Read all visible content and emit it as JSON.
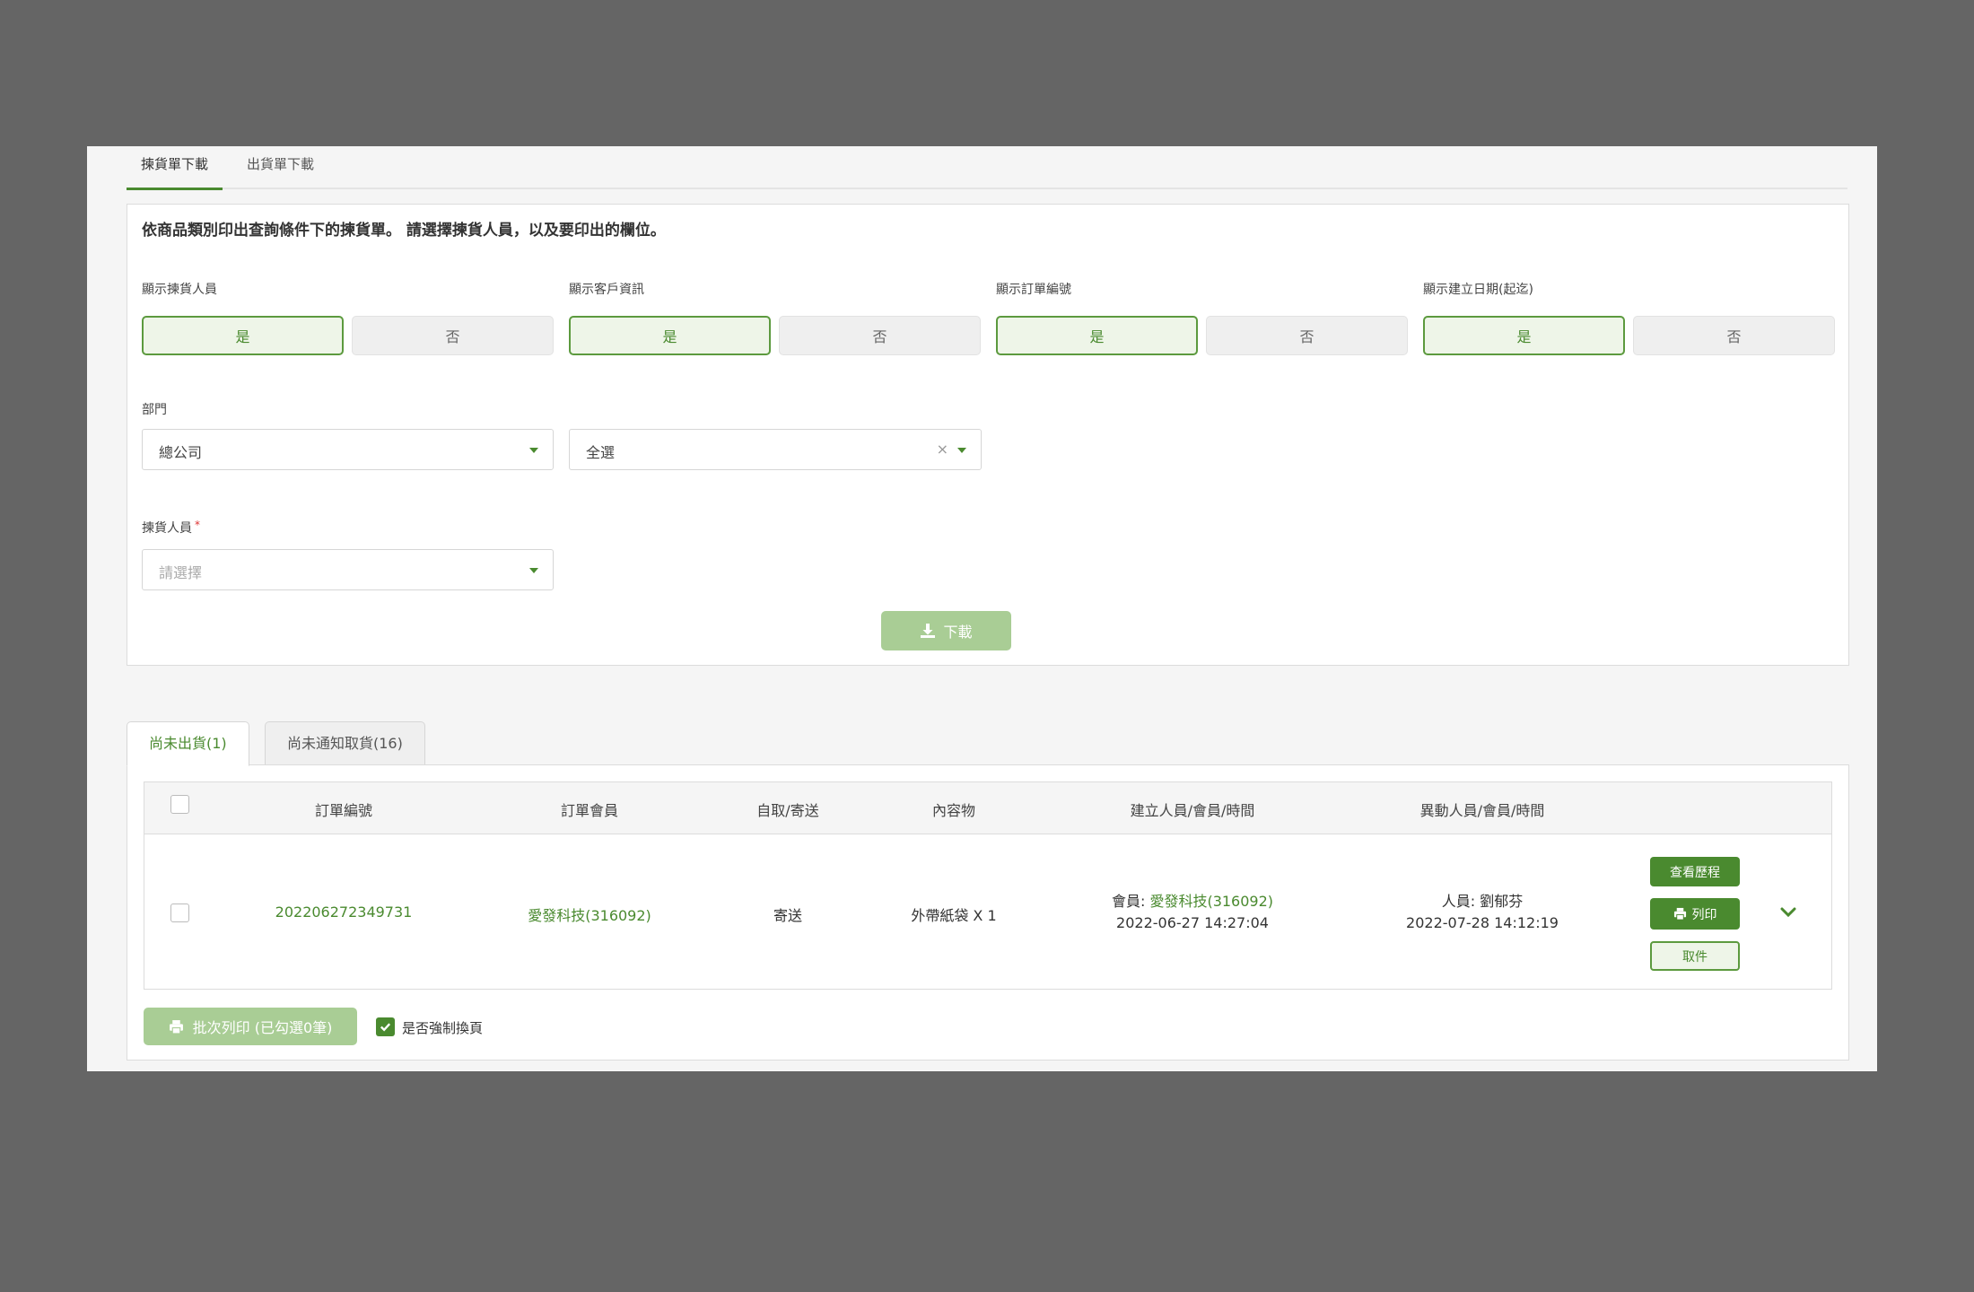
{
  "top_tabs": [
    {
      "label": "揀貨單下載",
      "active": true
    },
    {
      "label": "出貨單下載",
      "active": false
    }
  ],
  "card": {
    "description": "依商品類別印出查詢條件下的揀貨單。 請選擇揀貨人員，以及要印出的欄位。",
    "options": [
      {
        "label": "顯示揀貨人員",
        "yes": "是",
        "no": "否"
      },
      {
        "label": "顯示客戶資訊",
        "yes": "是",
        "no": "否"
      },
      {
        "label": "顯示訂單編號",
        "yes": "是",
        "no": "否"
      },
      {
        "label": "顯示建立日期(起迄)",
        "yes": "是",
        "no": "否"
      }
    ],
    "department_label": "部門",
    "department_value": "總公司",
    "department_sub_value": "全選",
    "picker_label": "揀貨人員",
    "picker_required": "*",
    "picker_placeholder": "請選擇",
    "download_label": "下載"
  },
  "sub_tabs": [
    {
      "label": "尚未出貨(1)",
      "active": true
    },
    {
      "label": "尚未通知取貨(16)",
      "active": false
    }
  ],
  "table": {
    "headers": [
      "訂單編號",
      "訂單會員",
      "自取/寄送",
      "內容物",
      "建立人員/會員/時間",
      "異動人員/會員/時間"
    ],
    "rows": [
      {
        "order_no": "202206272349731",
        "member": "愛發科技(316092)",
        "delivery": "寄送",
        "contents": "外帶紙袋 X 1",
        "created_prefix": "會員: ",
        "created_member": "愛發科技(316092)",
        "created_time": "2022-06-27 14:27:04",
        "modified_by": "人員: 劉郁芬",
        "modified_time": "2022-07-28 14:12:19",
        "actions": {
          "history": "查看歷程",
          "print": "列印",
          "cancel": "取件"
        }
      }
    ]
  },
  "footer": {
    "batch_print": "批次列印 (已勾選0筆)",
    "force_page_break": "是否強制換頁",
    "force_checked": true
  },
  "colors": {
    "accent": "#4a8a2f",
    "accent_light": "#eef5e8",
    "disabled_green": "#a9cd95",
    "backdrop": "#656565"
  }
}
